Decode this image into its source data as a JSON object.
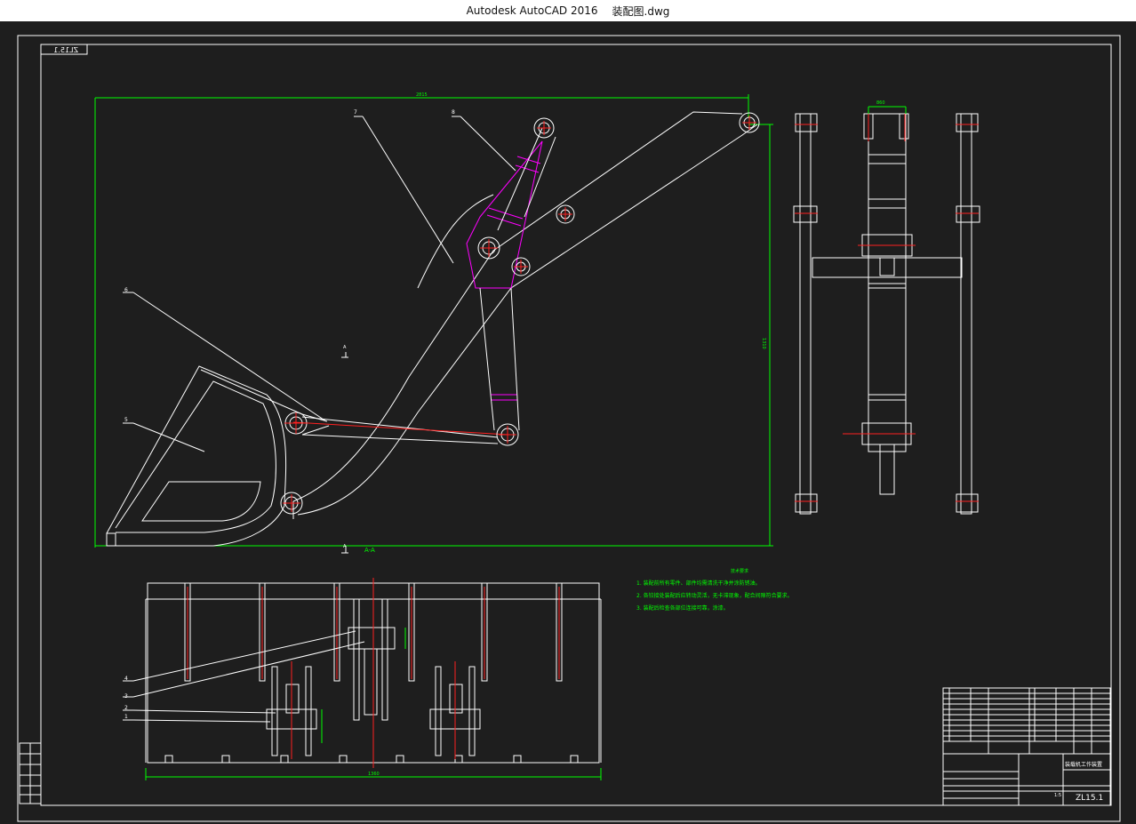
{
  "window": {
    "app_title": "Autodesk AutoCAD 2016",
    "file_name": "装配图.dwg"
  },
  "drawing": {
    "sheet_code_mirrored": "ZL15.1",
    "section_label": "A-A",
    "section_mark": "A",
    "dim_top": "2815",
    "dim_right": "1310",
    "dim_bottom": "1360",
    "dim_side_top": "860",
    "callouts": [
      "1",
      "2",
      "3",
      "4",
      "5",
      "6",
      "7",
      "8"
    ],
    "notes_title": "技术要求",
    "notes": [
      "1. 装配前所有零件、部件均需清洗干净并涂防锈油。",
      "2. 各铰接处装配后应转动灵活，无卡滞现象，配合间隙符合要求。",
      "3. 装配后检查各部位连接可靠，涂漆。"
    ],
    "title_block": {
      "drawing_number": "ZL15.1",
      "name": "装载机工作装置",
      "scale": "1:5"
    }
  },
  "colors": {
    "background": "#1e1e1e",
    "line": "#ffffff",
    "dimension": "#00ff00",
    "center": "#ff2020",
    "hidden": "#ff00ff"
  }
}
